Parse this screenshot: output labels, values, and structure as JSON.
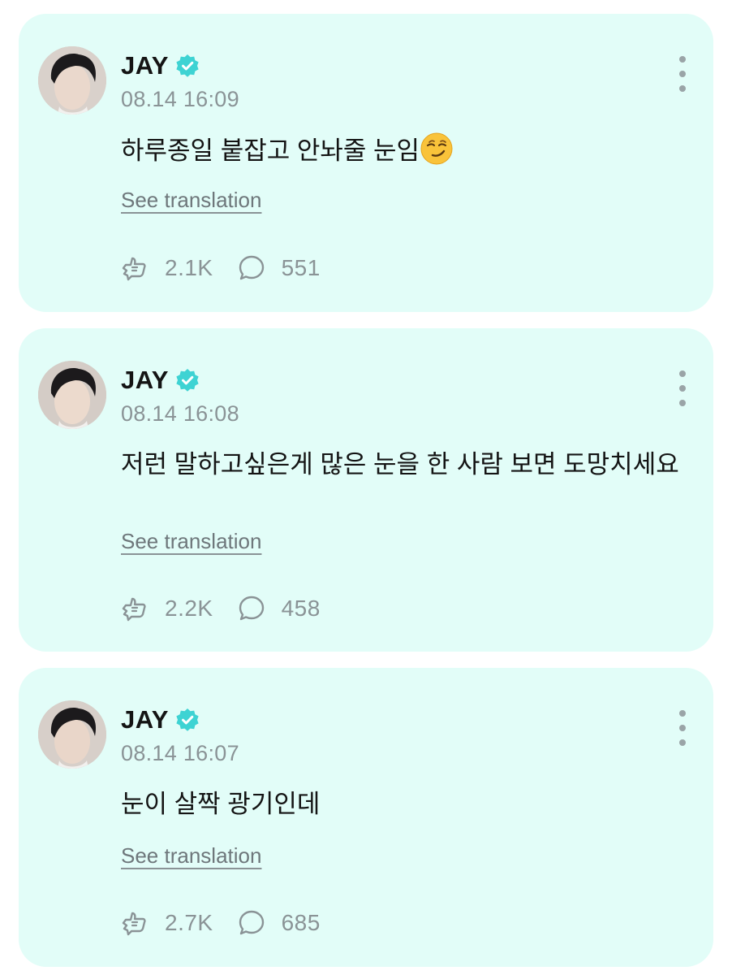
{
  "posts": [
    {
      "author": "JAY",
      "timestamp": "08.14 16:09",
      "text": "하루종일 붙잡고 안놔줄 눈임",
      "emoji": "smirking-face-icon",
      "translate_label": "See translation",
      "likes": "2.1K",
      "comments": "551"
    },
    {
      "author": "JAY",
      "timestamp": "08.14 16:08",
      "text": "저런 말하고싶은게 많은 눈을 한 사람 보면 도망치세요",
      "translate_label": "See translation",
      "likes": "2.2K",
      "comments": "458"
    },
    {
      "author": "JAY",
      "timestamp": "08.14 16:07",
      "text": "눈이 살짝 광기인데",
      "translate_label": "See translation",
      "likes": "2.7K",
      "comments": "685"
    }
  ],
  "colors": {
    "card_background": "#e2fdf8",
    "verified_badge": "#3ed3d3",
    "secondary_text": "#8a9396",
    "primary_text": "#141414"
  },
  "icons": {
    "verified": "verified-badge-icon",
    "more": "more-vertical-icon",
    "like": "like-icon",
    "comment": "comment-bubble-icon"
  }
}
